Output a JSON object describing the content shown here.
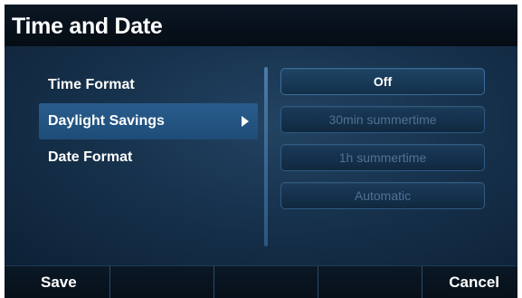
{
  "header": {
    "title": "Time and Date"
  },
  "menu": {
    "items": [
      {
        "label": "Time Format"
      },
      {
        "label": "Daylight Savings"
      },
      {
        "label": "Date Format"
      }
    ]
  },
  "options": {
    "items": [
      {
        "label": "Off"
      },
      {
        "label": "30min summertime"
      },
      {
        "label": "1h summertime"
      },
      {
        "label": "Automatic"
      }
    ]
  },
  "softkeys": {
    "save": "Save",
    "cancel": "Cancel"
  },
  "colors": {
    "accent": "#2a5d8d",
    "background": "#17324d"
  }
}
